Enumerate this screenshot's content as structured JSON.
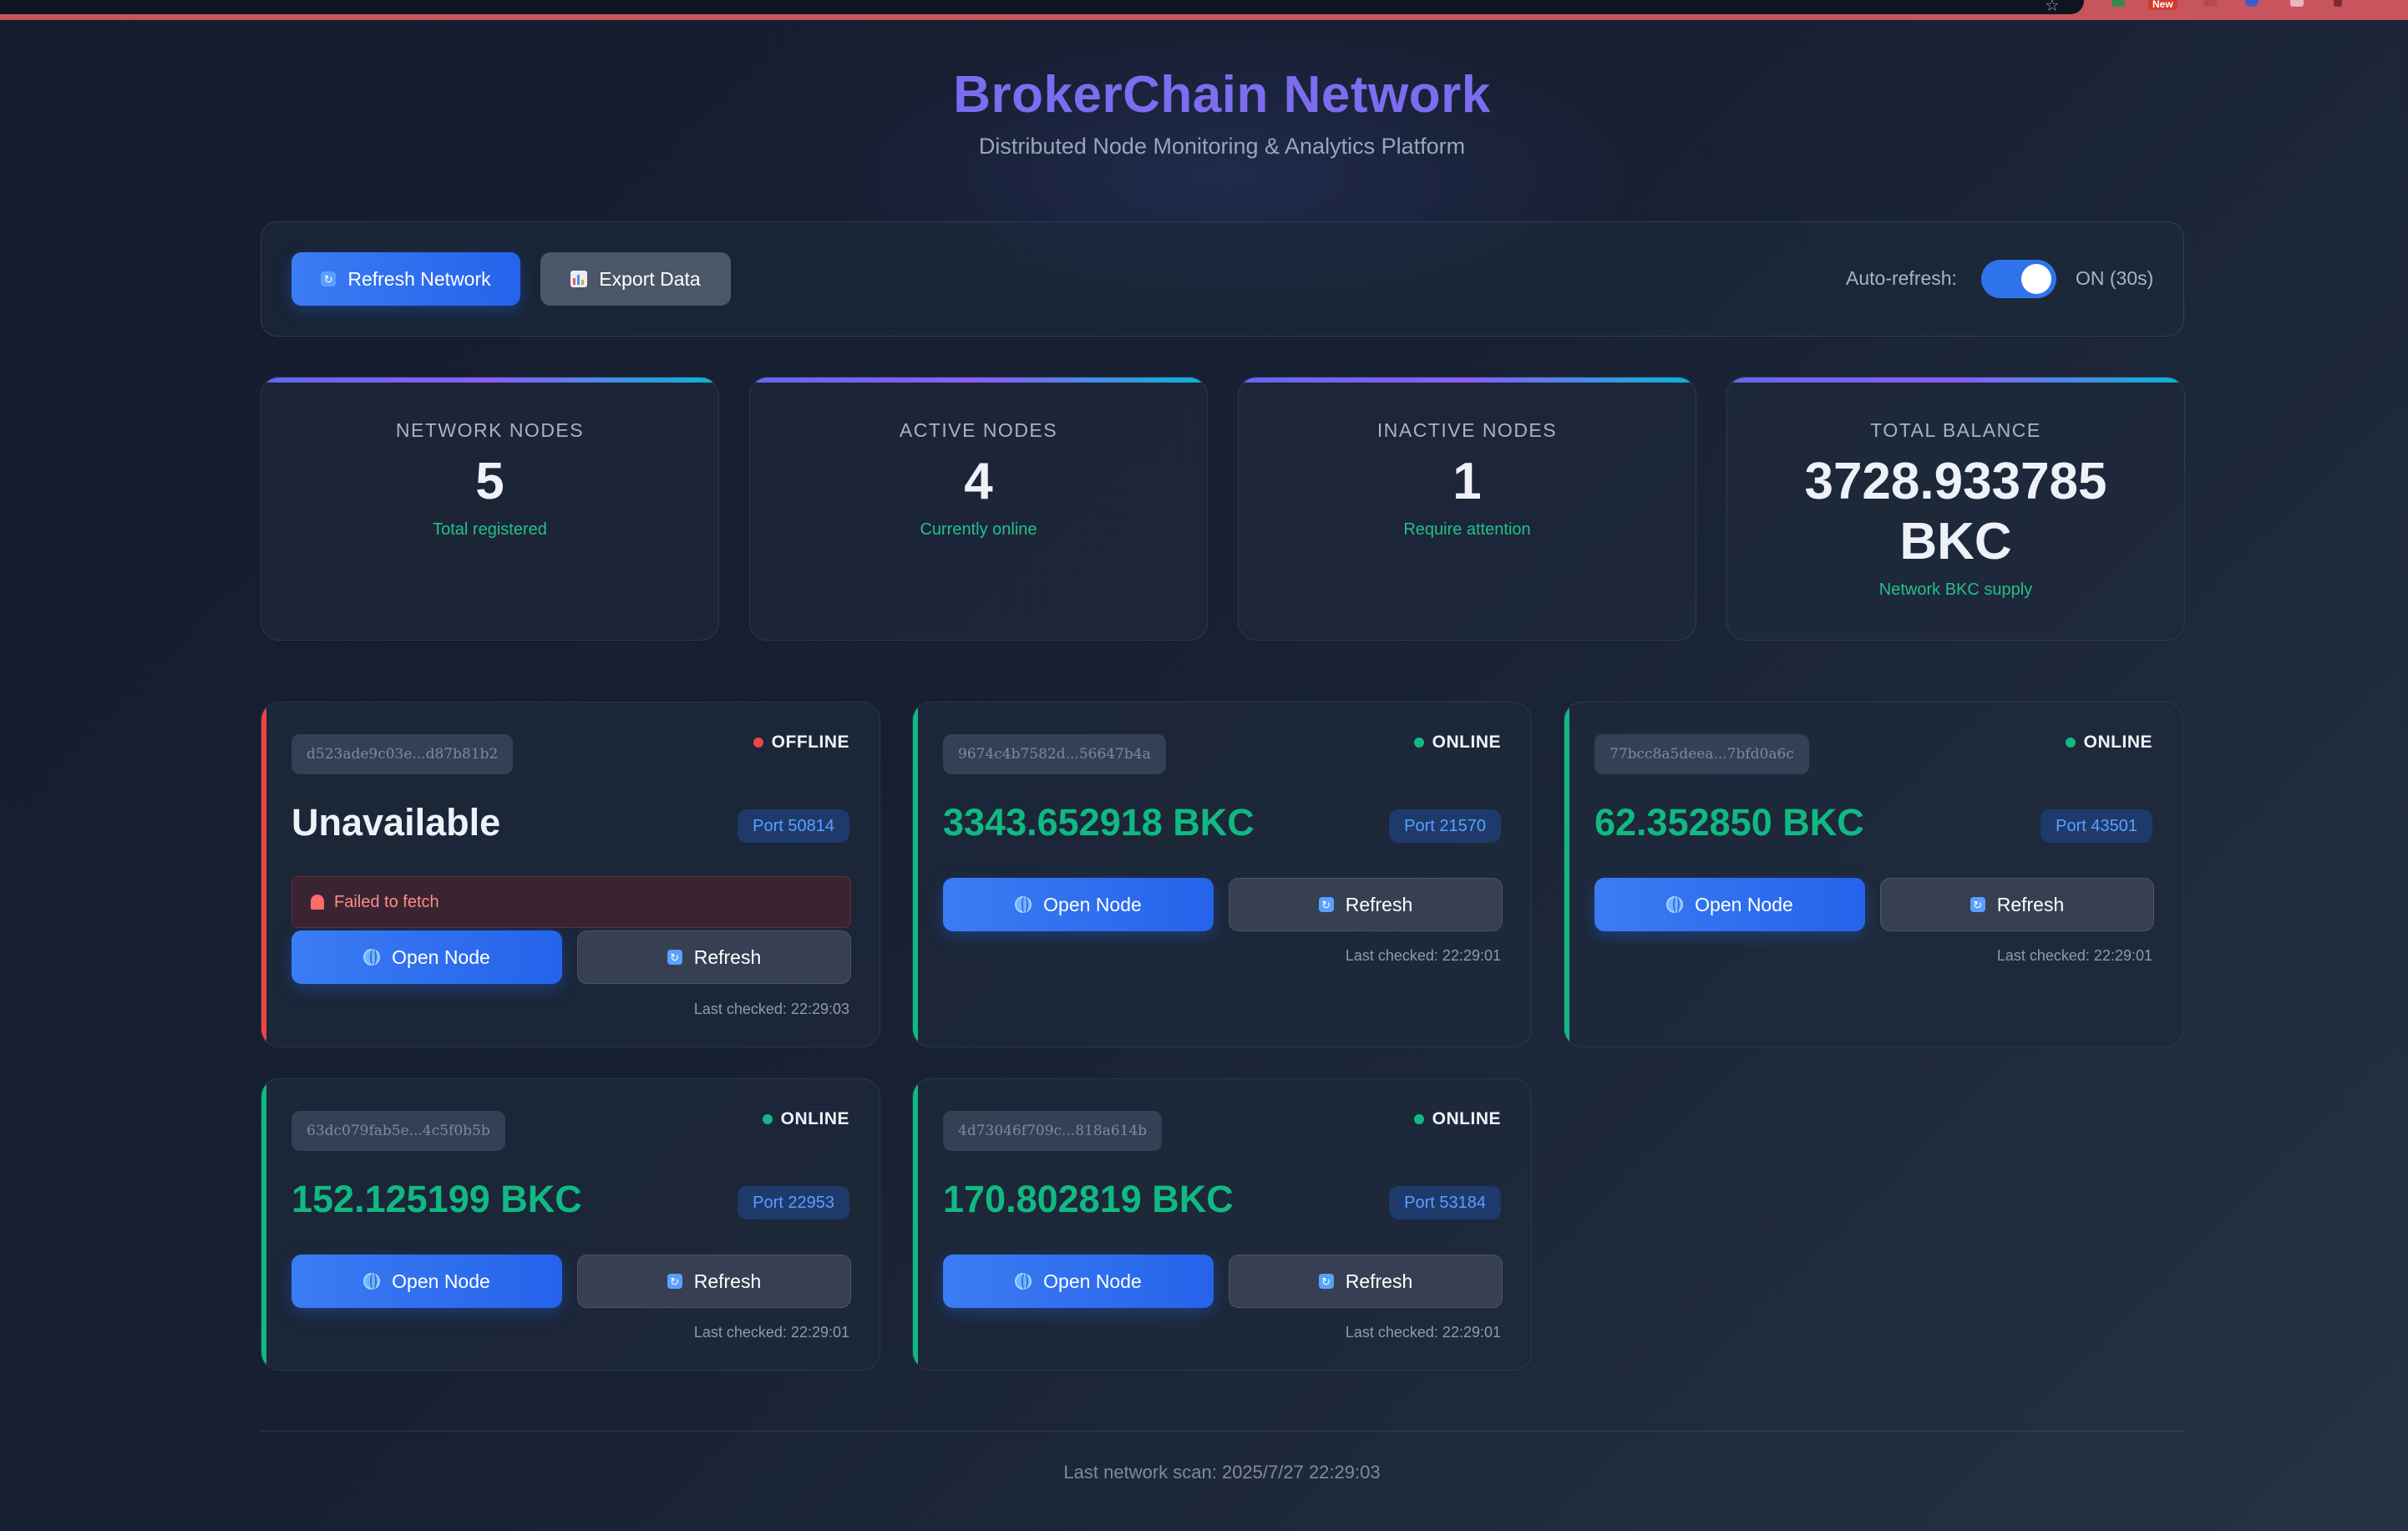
{
  "browser": {
    "new_badge": "New"
  },
  "header": {
    "title": "BrokerChain Network",
    "subtitle": "Distributed Node Monitoring & Analytics Platform"
  },
  "controls": {
    "refresh_network_label": "Refresh Network",
    "export_data_label": "Export Data",
    "auto_refresh_label": "Auto-refresh:",
    "auto_refresh_state": "ON (30s)",
    "auto_refresh_on": true
  },
  "stats": [
    {
      "label": "NETWORK NODES",
      "value": "5",
      "sub": "Total registered"
    },
    {
      "label": "ACTIVE NODES",
      "value": "4",
      "sub": "Currently online"
    },
    {
      "label": "INACTIVE NODES",
      "value": "1",
      "sub": "Require attention"
    },
    {
      "label": "TOTAL BALANCE",
      "value": "3728.933785 BKC",
      "value_line1": "3728.933785",
      "value_line2": "BKC",
      "sub": "Network BKC supply"
    }
  ],
  "nodes": [
    {
      "id": "d523ade9c03e...d87b81b2",
      "status": "OFFLINE",
      "balance": "Unavailable",
      "port": "Port 50814",
      "error": "Failed to fetch",
      "open_label": "Open Node",
      "refresh_label": "Refresh",
      "last_checked": "Last checked: 22:29:03"
    },
    {
      "id": "9674c4b7582d...56647b4a",
      "status": "ONLINE",
      "balance": "3343.652918 BKC",
      "port": "Port 21570",
      "open_label": "Open Node",
      "refresh_label": "Refresh",
      "last_checked": "Last checked: 22:29:01"
    },
    {
      "id": "77bcc8a5deea...7bfd0a6c",
      "status": "ONLINE",
      "balance": "62.352850 BKC",
      "port": "Port 43501",
      "open_label": "Open Node",
      "refresh_label": "Refresh",
      "last_checked": "Last checked: 22:29:01"
    },
    {
      "id": "63dc079fab5e...4c5f0b5b",
      "status": "ONLINE",
      "balance": "152.125199 BKC",
      "port": "Port 22953",
      "open_label": "Open Node",
      "refresh_label": "Refresh",
      "last_checked": "Last checked: 22:29:01"
    },
    {
      "id": "4d73046f709c...818a614b",
      "status": "ONLINE",
      "balance": "170.802819 BKC",
      "port": "Port 53184",
      "open_label": "Open Node",
      "refresh_label": "Refresh",
      "last_checked": "Last checked: 22:29:01"
    }
  ],
  "colors": {
    "online": "#10b981",
    "offline": "#ef4444",
    "balance_online": "#10b981",
    "balance_offline": "#eef2f8",
    "accent": "#2563eb"
  },
  "icons": {
    "refresh": "refresh-icon",
    "export": "chart-icon",
    "open_node": "globe-icon",
    "error": "alarm-icon"
  },
  "footer": {
    "last_scan": "Last network scan: 2025/7/27 22:29:03"
  }
}
